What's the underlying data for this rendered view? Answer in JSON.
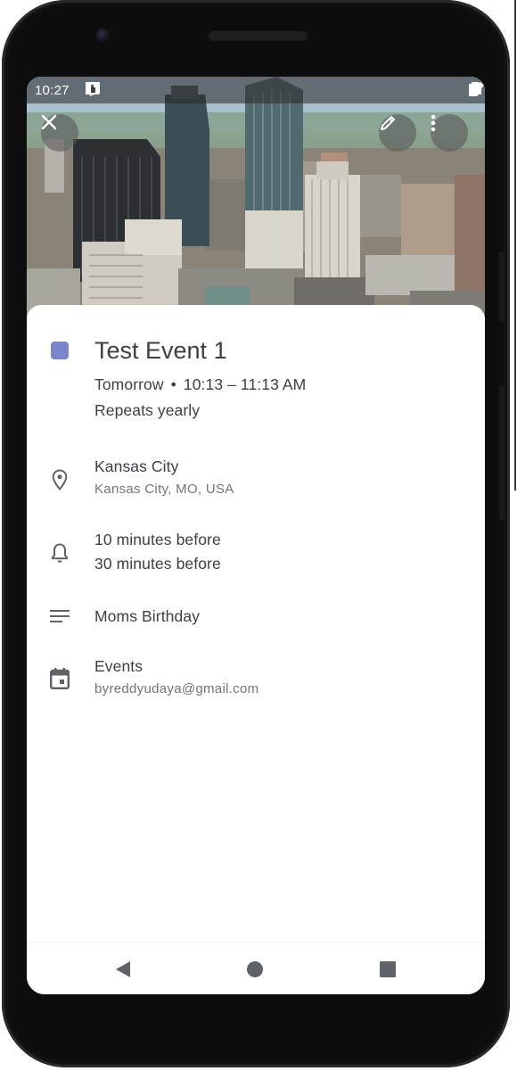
{
  "status_bar": {
    "time": "10:27",
    "left_icons": [
      "location-icon",
      "gmail-icon",
      "calendar-icon",
      "app-icon",
      "dot-icon"
    ],
    "right_icons": [
      "wifi-icon",
      "signal-icon",
      "battery-icon"
    ]
  },
  "header": {
    "close_icon": "close-icon",
    "edit_icon": "pencil-icon",
    "more_icon": "more-vert-icon"
  },
  "event": {
    "title": "Test Event 1",
    "date": "Tomorrow",
    "separator": "•",
    "time_range": "10:13 – 11:13 AM",
    "recurrence": "Repeats yearly",
    "color": "#7986cb"
  },
  "location": {
    "name": "Kansas City",
    "address": "Kansas City, MO, USA"
  },
  "notifications": {
    "first": "10 minutes before",
    "second": "30 minutes before"
  },
  "description": {
    "text": "Moms Birthday"
  },
  "calendar": {
    "name": "Events",
    "account": "byreddyudaya@gmail.com"
  },
  "nav": {
    "back_icon": "back-triangle-icon",
    "home_icon": "home-circle-icon",
    "recents_icon": "recents-square-icon"
  }
}
